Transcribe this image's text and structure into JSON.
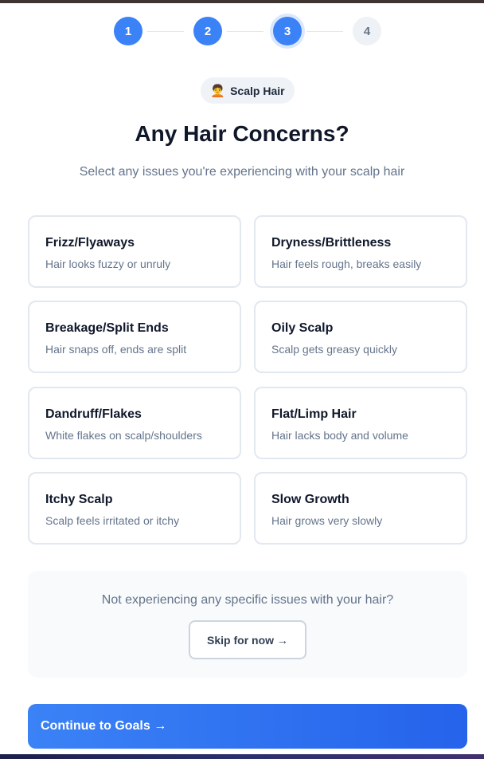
{
  "stepper": {
    "steps": [
      "1",
      "2",
      "3",
      "4"
    ],
    "current": 3
  },
  "badge": {
    "icon": "🧑‍🦱",
    "label": "Scalp Hair"
  },
  "header": {
    "title": "Any Hair Concerns?",
    "subtitle": "Select any issues you're experiencing with your scalp hair"
  },
  "concerns": [
    {
      "title": "Frizz/Flyaways",
      "desc": "Hair looks fuzzy or unruly"
    },
    {
      "title": "Dryness/Brittleness",
      "desc": "Hair feels rough, breaks easily"
    },
    {
      "title": "Breakage/Split Ends",
      "desc": "Hair snaps off, ends are split"
    },
    {
      "title": "Oily Scalp",
      "desc": "Scalp gets greasy quickly"
    },
    {
      "title": "Dandruff/Flakes",
      "desc": "White flakes on scalp/shoulders"
    },
    {
      "title": "Flat/Limp Hair",
      "desc": "Hair lacks body and volume"
    },
    {
      "title": "Itchy Scalp",
      "desc": "Scalp feels irritated or itchy"
    },
    {
      "title": "Slow Growth",
      "desc": "Hair grows very slowly"
    }
  ],
  "skip": {
    "prompt": "Not experiencing any specific issues with your hair?",
    "button_label": "Skip for now →"
  },
  "continue_label": "Continue to Goals →",
  "colors": {
    "accent": "#3b82f6",
    "accent_dark": "#2563eb",
    "border": "#e2e8f0",
    "muted_text": "#64748b"
  }
}
